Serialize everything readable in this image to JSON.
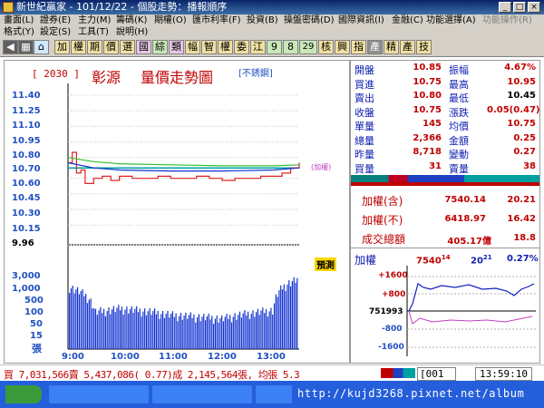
{
  "window": {
    "title": "新世紀贏家 - 101/12/22 - 個股走勢：播報順序"
  },
  "menu_row1": [
    "畫面(L)",
    "證券(E)",
    "主力(M)",
    "籌碼(K)",
    "期權(O)",
    "匯市利率(F)",
    "投資(B)",
    "操盤密碼(D)",
    "國際資訊(I)",
    "金融(C)",
    "功能選擇(A)",
    "功能操作(R)"
  ],
  "menu_row2": [
    "格式(Y)",
    "設定(S)",
    "工具(T)",
    "說明(H)"
  ],
  "toolbar": [
    "加",
    "權",
    "期",
    "價",
    "選",
    "國",
    "綜",
    "類",
    "幅",
    "智",
    "權",
    "委",
    "江",
    "9",
    "8",
    "29",
    "核",
    "興",
    "指",
    "產",
    "精",
    "產",
    "技"
  ],
  "chart": {
    "code": "[ 2030 ]",
    "name": "彰源",
    "title": "量價走勢圖",
    "mode": "[不銹鋼]",
    "index_label": "(加權)",
    "reference_badge": "預測",
    "price_ticks": [
      "11.40",
      "11.25",
      "11.10",
      "10.95",
      "10.80",
      "10.70",
      "10.60",
      "10.45",
      "10.30",
      "10.15",
      "9.96"
    ],
    "volume_ticks": [
      "3,000",
      "1,000",
      "500",
      "100",
      "50",
      "15"
    ],
    "volume_unit": "張",
    "time_ticks": [
      "9:00",
      "10:00",
      "11:00",
      "12:00",
      "13:00"
    ]
  },
  "chart_data": {
    "type": "line",
    "title": "量價走勢圖",
    "series": [
      {
        "name": "price",
        "x": [
          "9:00",
          "9:05",
          "9:10",
          "9:15",
          "9:20",
          "9:30",
          "9:40",
          "9:50",
          "10:00",
          "10:15",
          "10:30",
          "10:45",
          "11:00",
          "11:15",
          "11:30",
          "11:45",
          "12:00",
          "12:15",
          "12:30",
          "12:45",
          "13:00",
          "13:10",
          "13:20",
          "13:30"
        ],
        "values": [
          10.75,
          10.85,
          10.65,
          10.68,
          10.55,
          10.6,
          10.62,
          10.58,
          10.62,
          10.6,
          10.6,
          10.62,
          10.6,
          10.6,
          10.62,
          10.6,
          10.58,
          10.6,
          10.6,
          10.62,
          10.62,
          10.65,
          10.7,
          10.75
        ]
      },
      {
        "name": "average",
        "x": [
          "9:00",
          "9:30",
          "10:00",
          "11:00",
          "12:00",
          "13:00",
          "13:30"
        ],
        "values": [
          10.75,
          10.7,
          10.68,
          10.67,
          10.67,
          10.68,
          10.7
        ]
      },
      {
        "name": "加權",
        "x": [
          "9:00",
          "9:30",
          "10:00",
          "11:00",
          "12:00",
          "13:00",
          "13:30"
        ],
        "values": [
          10.8,
          10.76,
          10.74,
          10.73,
          10.72,
          10.72,
          10.73
        ]
      }
    ],
    "volume": {
      "x": [
        "9:00",
        "9:30",
        "10:00",
        "11:00",
        "12:00",
        "13:00",
        "13:30"
      ],
      "values": [
        1200,
        80,
        120,
        60,
        40,
        100,
        3000
      ]
    },
    "ylim": [
      9.96,
      11.4
    ],
    "reference": 10.7
  },
  "quote": {
    "rows": [
      {
        "l1": "開盤",
        "v1": "10.85",
        "l2": "振幅",
        "v2": "4.67%"
      },
      {
        "l1": "買進",
        "v1": "10.75",
        "l2": "最高",
        "v2": "10.95"
      },
      {
        "l1": "賣出",
        "v1": "10.80",
        "l2": "最低",
        "v2": "10.45"
      },
      {
        "l1": "收盤",
        "v1": "10.75",
        "l2": "漲跌",
        "v2": "0.05(0.47)"
      },
      {
        "l1": "單量",
        "v1": "145",
        "l2": "均價",
        "v2": "10.75"
      },
      {
        "l1": "總量",
        "v1": "2,366",
        "l2": "金額",
        "v2": "0.25"
      },
      {
        "l1": "昨量",
        "v1": "8,718",
        "l2": "變動",
        "v2": "0.27"
      },
      {
        "l1": "買量",
        "v1": "31",
        "l2": "賣量",
        "v2": "38"
      }
    ]
  },
  "index_box": {
    "r1_label": "加權(含)",
    "r1_value": "7540.14",
    "r1_change": "20.21",
    "r2_label": "加權(不)",
    "r2_value": "6418.97",
    "r2_change": "16.42",
    "r3_label": "成交總額",
    "r3_value": "405.17億",
    "r3_change": "18.8"
  },
  "mini_chart": {
    "label": "加權",
    "value": "7540",
    "value_dec": "14",
    "change": "20",
    "change_dec": "21",
    "pct": "0.27%",
    "ticks": [
      "+1600",
      "+800",
      "751993",
      "-800",
      "-1600"
    ]
  },
  "status": {
    "summary": "買 7,031,566賣 5,437,086( 0.77)成 2,145,564張, 均張 5.3",
    "code": "[001",
    "time": "13:59:10"
  },
  "watermark": "http://kujd3268.pixnet.net/album"
}
